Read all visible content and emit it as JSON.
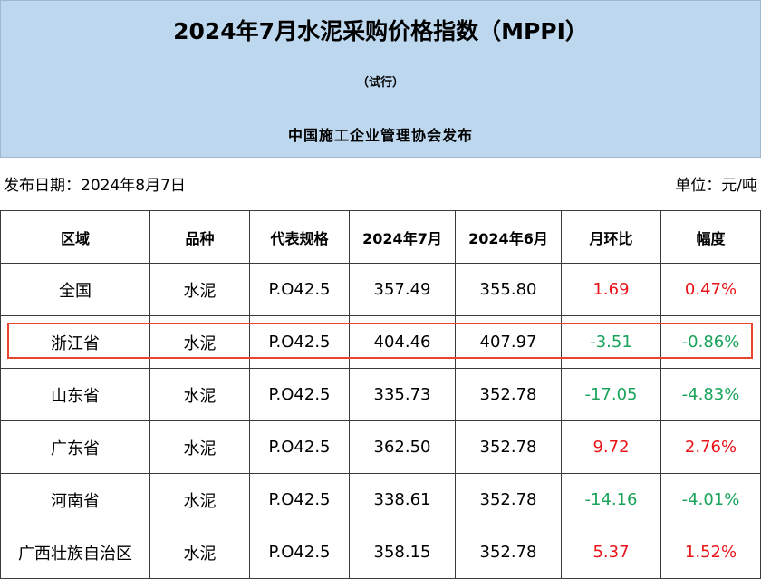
{
  "header": {
    "title": "2024年7月水泥采购价格指数（MPPI）",
    "subtitle": "（试行）",
    "publisher": "中国施工企业管理协会发布"
  },
  "meta": {
    "date": "发布日期：2024年8月7日",
    "unit": "单位：元/吨"
  },
  "colors": {
    "header_bg": "#bdd7ee",
    "increase": "#e8141a",
    "decrease": "#1aa35a",
    "highlight": "#e8442d"
  },
  "table": {
    "headers": [
      "区域",
      "品种",
      "代表规格",
      "2024年7月",
      "2024年6月",
      "月环比",
      "幅度"
    ],
    "rows": [
      {
        "region": "全国",
        "variety": "水泥",
        "spec": "P.O42.5",
        "jul": "357.49",
        "jun": "355.80",
        "mom": "1.69",
        "pct": "0.47%",
        "trend": "up"
      },
      {
        "region": "浙江省",
        "variety": "水泥",
        "spec": "P.O42.5",
        "jul": "404.46",
        "jun": "407.97",
        "mom": "-3.51",
        "pct": "-0.86%",
        "trend": "down"
      },
      {
        "region": "山东省",
        "variety": "水泥",
        "spec": "P.O42.5",
        "jul": "335.73",
        "jun": "352.78",
        "mom": "-17.05",
        "pct": "-4.83%",
        "trend": "down"
      },
      {
        "region": "广东省",
        "variety": "水泥",
        "spec": "P.O42.5",
        "jul": "362.50",
        "jun": "352.78",
        "mom": "9.72",
        "pct": "2.76%",
        "trend": "up"
      },
      {
        "region": "河南省",
        "variety": "水泥",
        "spec": "P.O42.5",
        "jul": "338.61",
        "jun": "352.78",
        "mom": "-14.16",
        "pct": "-4.01%",
        "trend": "down"
      },
      {
        "region": "广西壮族自治区",
        "variety": "水泥",
        "spec": "P.O42.5",
        "jul": "358.15",
        "jun": "352.78",
        "mom": "5.37",
        "pct": "1.52%",
        "trend": "up"
      }
    ]
  }
}
